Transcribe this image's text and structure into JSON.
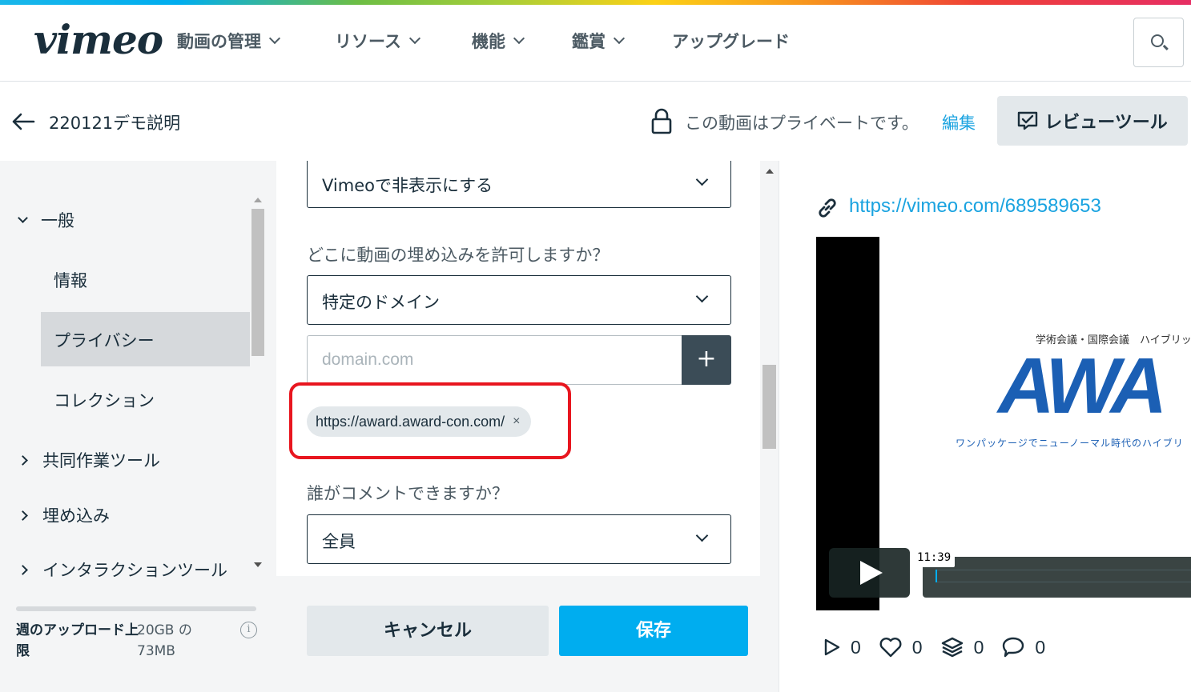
{
  "nav": {
    "logo": "vimeo",
    "items": [
      {
        "label": "動画の管理",
        "dropdown": true
      },
      {
        "label": "リソース",
        "dropdown": true
      },
      {
        "label": "機能",
        "dropdown": true
      },
      {
        "label": "鑑賞",
        "dropdown": true
      },
      {
        "label": "アップグレード",
        "dropdown": false
      }
    ],
    "search_icon": "search-icon"
  },
  "video_header": {
    "title": "220121デモ説明",
    "privacy_text": "この動画はプライベートです。",
    "edit_label": "編集",
    "review_tool_label": "レビューツール"
  },
  "sidebar": {
    "section_general": "一般",
    "items": [
      "情報",
      "プライバシー",
      "コレクション"
    ],
    "selected": "プライバシー",
    "collapsed_sections": [
      "共同作業ツール",
      "埋め込み",
      "インタラクションツール"
    ],
    "quota_label": "週のアップロード上限",
    "quota_value": "20GB の 73MB"
  },
  "form": {
    "visibility_select": "Vimeoで非表示にする",
    "embed_question": "どこに動画の埋め込みを許可しますか？",
    "embed_select": "特定のドメイン",
    "domain_placeholder": "domain.com",
    "add_label": "+",
    "domain_chip": "https://award.award-con.com/",
    "chip_remove": "×",
    "comment_question": "誰がコメントできますか？",
    "comment_select": "全員"
  },
  "footer": {
    "cancel_label": "キャンセル",
    "save_label": "保存"
  },
  "preview": {
    "url": "https://vimeo.com/689589653",
    "slide_top_text": "学術会議・国際会議　ハイブリッ",
    "slide_logo": "AWA",
    "slide_sub_text": "ワンパッケージでニューノーマル時代のハイブリ",
    "time_tooltip": "11:39",
    "stats": {
      "plays": "0",
      "likes": "0",
      "collections": "0",
      "comments": "0"
    }
  },
  "colors": {
    "accent": "#00adef",
    "link": "#1aa3e0",
    "highlight": "#e8161f",
    "text": "#1a2e3b"
  }
}
